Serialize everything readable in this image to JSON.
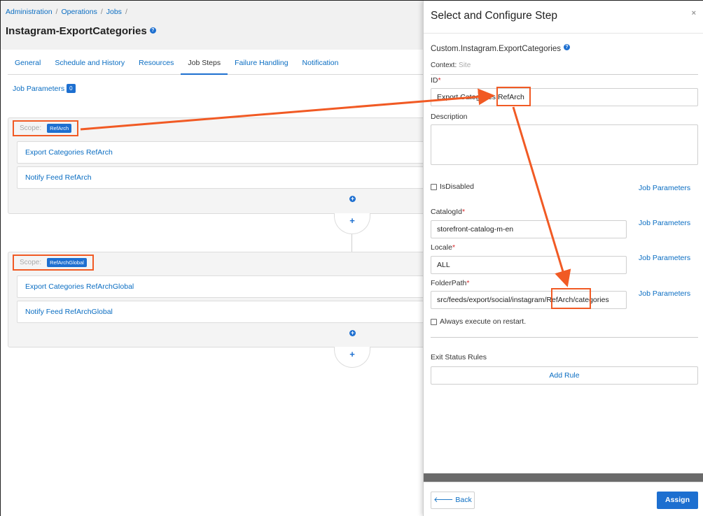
{
  "breadcrumb": [
    "Administration",
    "Operations",
    "Jobs"
  ],
  "page_title": "Instagram-ExportCategories",
  "tabs": [
    {
      "label": "General"
    },
    {
      "label": "Schedule and History"
    },
    {
      "label": "Resources"
    },
    {
      "label": "Job Steps",
      "active": true
    },
    {
      "label": "Failure Handling"
    },
    {
      "label": "Notification"
    }
  ],
  "job_parameters": {
    "label": "Job Parameters",
    "count": "0"
  },
  "scopes": [
    {
      "label": "Scope:",
      "tag": "RefArch",
      "steps": [
        "Export Categories RefArch",
        "Notify Feed RefArch"
      ]
    },
    {
      "label": "Scope:",
      "tag": "RefArchGlobal",
      "steps": [
        "Export Categories RefArchGlobal",
        "Notify Feed RefArchGlobal"
      ]
    }
  ],
  "panel": {
    "title": "Select and Configure Step",
    "close": "×",
    "subtitle": "Custom.Instagram.ExportCategories",
    "context_label": "Context:",
    "context_value": "Site",
    "id_label": "ID",
    "id_value": "Export Categories RefArch",
    "description_label": "Description",
    "is_disabled_label": "IsDisabled",
    "job_parameters_link": "Job Parameters",
    "catalog_label": "CatalogId",
    "catalog_value": "storefront-catalog-m-en",
    "locale_label": "Locale",
    "locale_value": "ALL",
    "folder_label": "FolderPath",
    "folder_value": "src/feeds/export/social/instagram/RefArch/categories",
    "always_execute_label": "Always execute on restart.",
    "exit_status_label": "Exit Status Rules",
    "add_rule_label": "Add Rule",
    "back_label": "Back",
    "assign_label": "Assign"
  },
  "required_mark": "*",
  "colors": {
    "accent": "#1d6fd0",
    "link": "#0a6dc2",
    "highlight": "#f15a24"
  }
}
